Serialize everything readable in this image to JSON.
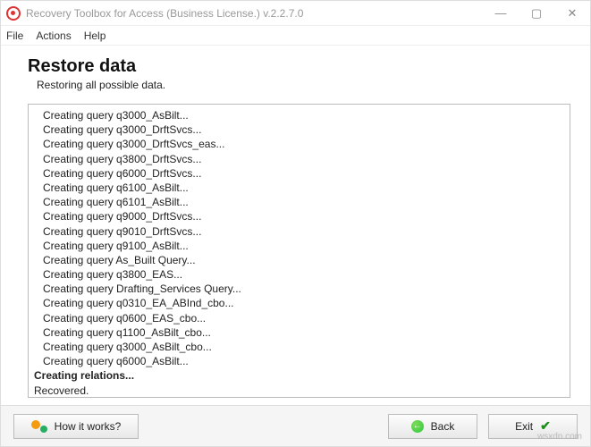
{
  "window": {
    "title": "Recovery Toolbox for Access (Business License.) v.2.2.7.0"
  },
  "menu": {
    "file": "File",
    "actions": "Actions",
    "help": "Help"
  },
  "page": {
    "heading": "Restore data",
    "subheading": "Restoring all possible data."
  },
  "log": [
    "Creating query q3000_AsBilt...",
    "Creating query q3000_DrftSvcs...",
    "Creating query q3000_DrftSvcs_eas...",
    "Creating query q3800_DrftSvcs...",
    "Creating query q6000_DrftSvcs...",
    "Creating query q6100_AsBilt...",
    "Creating query q6101_AsBilt...",
    "Creating query q9000_DrftSvcs...",
    "Creating query q9010_DrftSvcs...",
    "Creating query q9100_AsBilt...",
    "Creating query As_Built Query...",
    "Creating query q3800_EAS...",
    "Creating query Drafting_Services Query...",
    "Creating query q0310_EA_ABInd_cbo...",
    "Creating query q0600_EAS_cbo...",
    "Creating query q1100_AsBilt_cbo...",
    "Creating query q3000_AsBilt_cbo...",
    "Creating query q6000_AsBilt..."
  ],
  "log_bold": "Creating relations...",
  "log_final": "Recovered.",
  "buttons": {
    "how": "How it works?",
    "back": "Back",
    "exit": "Exit"
  },
  "watermark": "wsxdn.com"
}
